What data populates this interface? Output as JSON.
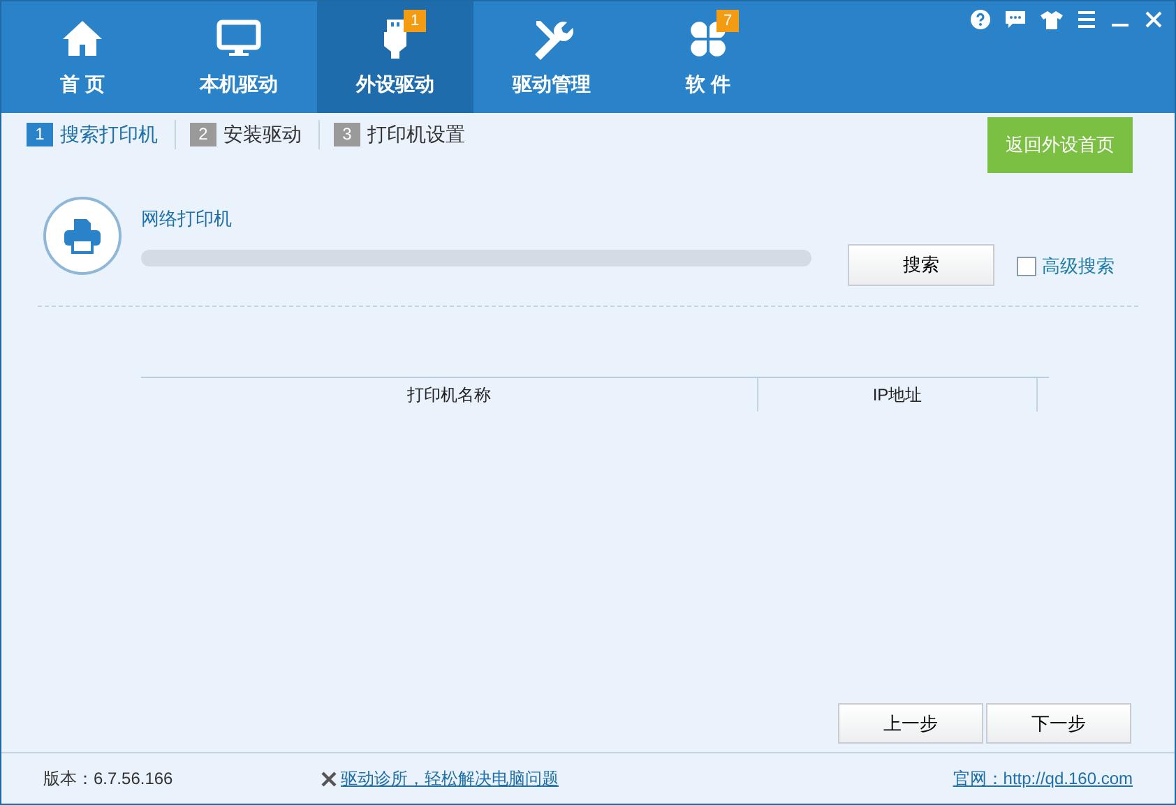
{
  "nav_tabs": [
    {
      "label": "首 页",
      "selected": false
    },
    {
      "label": "本机驱动",
      "selected": false
    },
    {
      "label": "外设驱动",
      "selected": true,
      "badge": "1"
    },
    {
      "label": "驱动管理",
      "selected": false
    },
    {
      "label": "软 件",
      "selected": false,
      "badge": "7"
    }
  ],
  "steps": [
    {
      "number": "1",
      "label": "搜索打印机",
      "selected": true
    },
    {
      "number": "2",
      "label": "安装驱动",
      "selected": false
    },
    {
      "number": "3",
      "label": "打印机设置",
      "selected": false
    }
  ],
  "back_button": "返回外设首页",
  "search_panel": {
    "title": "网络打印机",
    "search_button": "搜索",
    "advanced": {
      "label": "高级搜索",
      "checked": false
    }
  },
  "table": {
    "columns": [
      "打印机名称",
      "IP地址"
    ]
  },
  "buttons": [
    "上一步",
    "下一步"
  ],
  "status_bar": {
    "version": "版本：6.7.56.166",
    "link": "驱动诊所，轻松解决电脑问题",
    "website": "官网：http://qd.160.com"
  }
}
